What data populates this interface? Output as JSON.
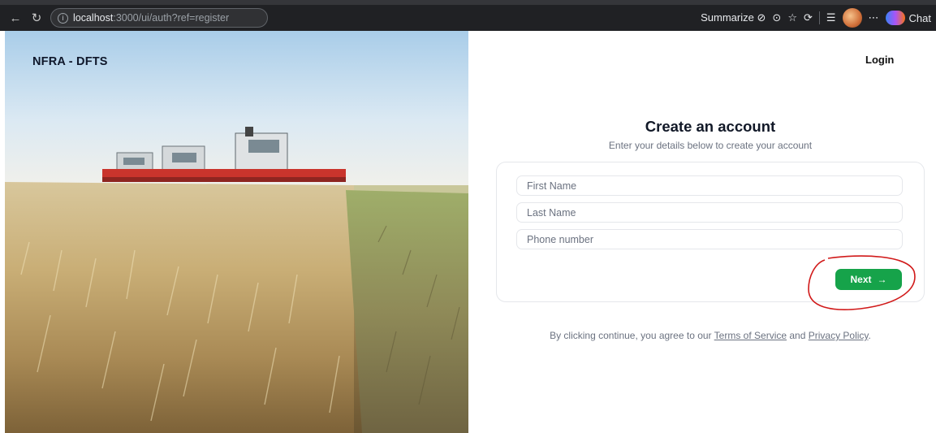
{
  "browser": {
    "url_host": "localhost",
    "url_rest": ":3000/ui/auth?ref=register",
    "summarize_label": "Summarize",
    "chat_label": "Chat"
  },
  "brand": {
    "name": "NFRA - DFTS"
  },
  "header": {
    "login_label": "Login"
  },
  "form": {
    "title": "Create an account",
    "subtitle": "Enter your details below to create your account",
    "first_name_placeholder": "First Name",
    "last_name_placeholder": "Last Name",
    "phone_placeholder": "Phone number",
    "next_label": "Next",
    "next_arrow": "→"
  },
  "legal": {
    "prefix": "By clicking continue, you agree to our",
    "terms": "Terms of Service",
    "and": "and",
    "privacy": "Privacy Policy",
    "suffix": "."
  },
  "colors": {
    "accent_green": "#16a34a",
    "annotation_red": "#d11a1a"
  }
}
